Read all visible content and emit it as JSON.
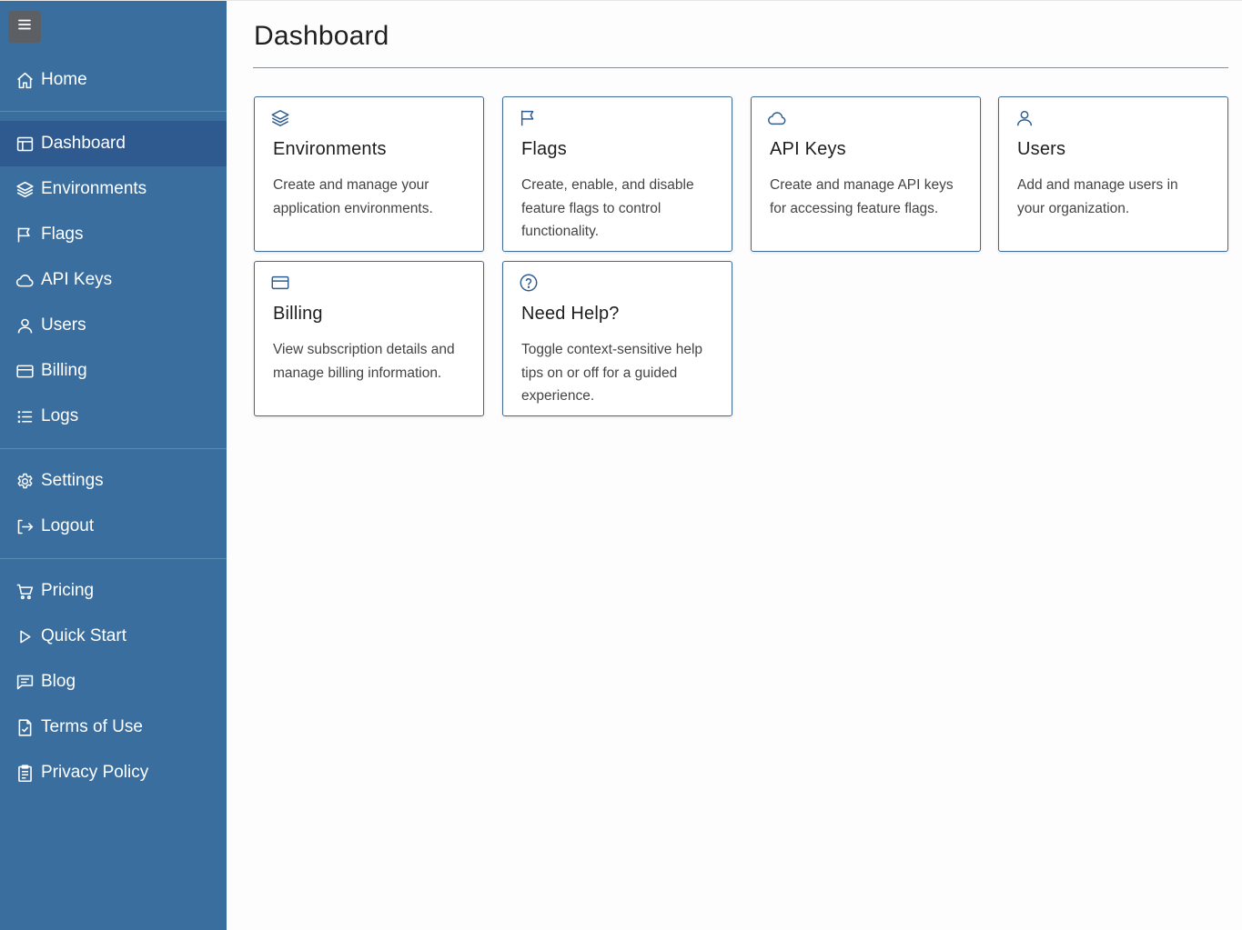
{
  "sidebar": {
    "nav": {
      "home": "Home",
      "dashboard": "Dashboard",
      "environments": "Environments",
      "flags": "Flags",
      "api_keys": "API Keys",
      "users": "Users",
      "billing": "Billing",
      "logs": "Logs",
      "settings": "Settings",
      "logout": "Logout",
      "pricing": "Pricing",
      "quick_start": "Quick Start",
      "blog": "Blog",
      "terms": "Terms of Use",
      "privacy": "Privacy Policy"
    },
    "active": "Dashboard"
  },
  "main": {
    "title": "Dashboard",
    "cards": [
      {
        "icon": "layers-icon",
        "title": "Environments",
        "description": "Create and manage your application environments."
      },
      {
        "icon": "flag-icon",
        "title": "Flags",
        "description": "Create, enable, and disable feature flags to control functionality."
      },
      {
        "icon": "cloud-icon",
        "title": "API Keys",
        "description": "Create and manage API keys for accessing feature flags."
      },
      {
        "icon": "user-icon",
        "title": "Users",
        "description": "Add and manage users in your organization."
      },
      {
        "icon": "credit-card-icon",
        "title": "Billing",
        "description": "View subscription details and manage billing information."
      },
      {
        "icon": "question-circle-icon",
        "title": "Need Help?",
        "description": "Toggle context-sensitive help tips on or off for a guided experience."
      }
    ]
  },
  "colors": {
    "sidebar_bg": "#3a6e9e",
    "sidebar_active": "#2f5a8f",
    "card_border": "#3f6b98",
    "icon_accent": "#2f5d8f"
  }
}
